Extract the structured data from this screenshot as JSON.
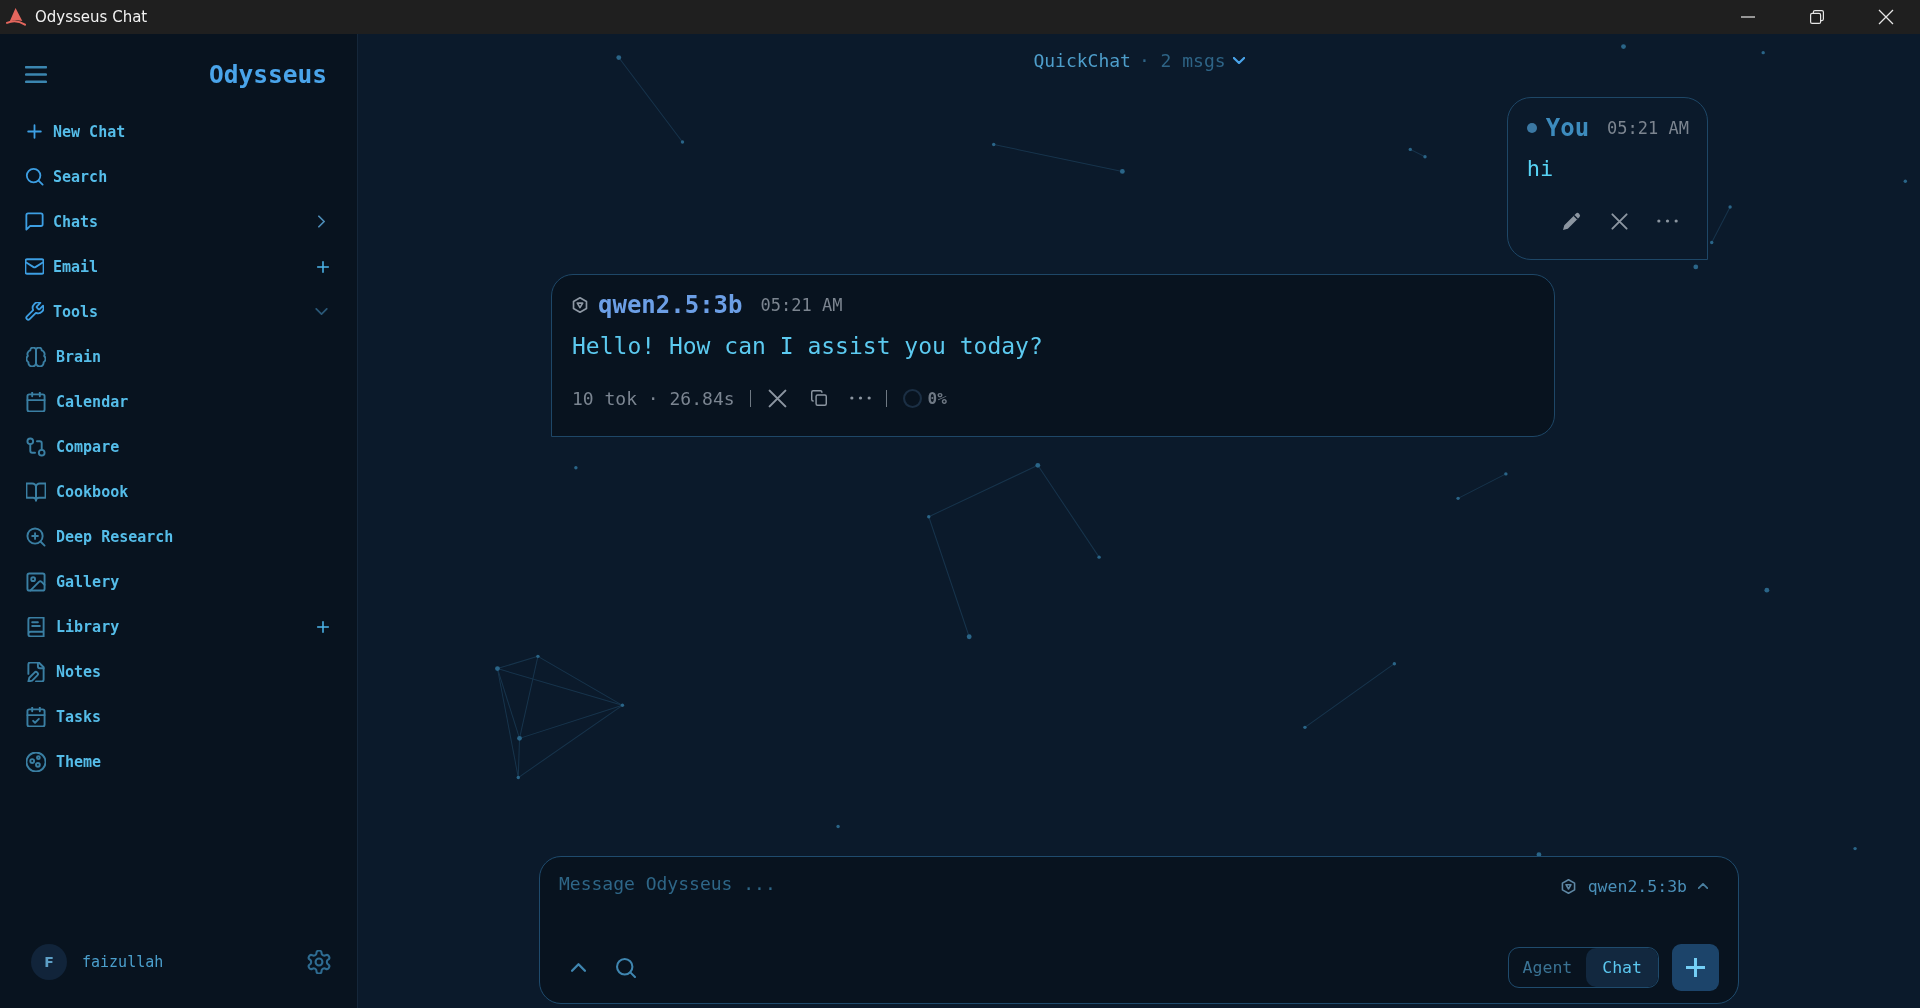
{
  "window": {
    "title": "Odysseus Chat"
  },
  "sidebar": {
    "brand": "Odysseus",
    "items": [
      {
        "label": "New Chat",
        "kind": "link"
      },
      {
        "label": "Search",
        "kind": "link"
      },
      {
        "label": "Chats",
        "kind": "folder",
        "expanded": false
      },
      {
        "label": "Email",
        "kind": "addable"
      },
      {
        "label": "Tools",
        "kind": "folder",
        "expanded": true,
        "children": [
          {
            "label": "Brain",
            "kind": "link"
          },
          {
            "label": "Calendar",
            "kind": "link"
          },
          {
            "label": "Compare",
            "kind": "link"
          },
          {
            "label": "Cookbook",
            "kind": "link"
          },
          {
            "label": "Deep Research",
            "kind": "link"
          },
          {
            "label": "Gallery",
            "kind": "link"
          },
          {
            "label": "Library",
            "kind": "addable"
          },
          {
            "label": "Notes",
            "kind": "link"
          },
          {
            "label": "Tasks",
            "kind": "link"
          },
          {
            "label": "Theme",
            "kind": "link"
          }
        ]
      }
    ],
    "user": {
      "initial": "F",
      "name": "faizullah"
    }
  },
  "chat": {
    "title": "QuickChat",
    "meta": "· 2 msgs",
    "messages": [
      {
        "kind": "user",
        "author": "You",
        "time": "05:21 AM",
        "text": "hi"
      },
      {
        "kind": "assistant",
        "author": "qwen2.5:3b",
        "time": "05:21 AM",
        "text": "Hello! How can I assist you today?",
        "stats": "10 tok · 26.84s",
        "usage": "0%"
      }
    ]
  },
  "composer": {
    "placeholder": "Message Odysseus ...",
    "model": "qwen2.5:3b",
    "modes": [
      {
        "label": "Agent",
        "selected": false
      },
      {
        "label": "Chat",
        "selected": true
      }
    ]
  }
}
